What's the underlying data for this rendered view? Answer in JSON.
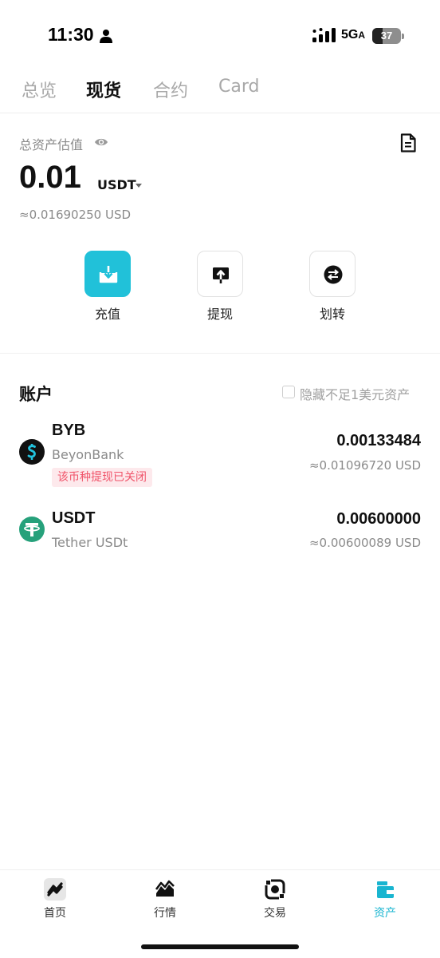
{
  "status_bar": {
    "time": "11:30",
    "network": "5G",
    "network_suffix": "A",
    "battery": "37",
    "icons": [
      "person-icon",
      "signal-icon",
      "battery-icon"
    ]
  },
  "tabs": [
    {
      "label": "总览",
      "active": false
    },
    {
      "label": "现货",
      "active": true
    },
    {
      "label": "合约",
      "active": false
    },
    {
      "label": "Card",
      "active": false
    }
  ],
  "summary": {
    "label": "总资产估值",
    "value": "0.01",
    "currency": "USDT",
    "usd_equiv": "≈0.01690250 USD",
    "icons": [
      "eye-icon",
      "document-icon",
      "caret-down-icon"
    ]
  },
  "actions": [
    {
      "label": "充值",
      "icon": "deposit-icon",
      "primary": true
    },
    {
      "label": "提现",
      "icon": "withdraw-icon",
      "primary": false
    },
    {
      "label": "划转",
      "icon": "transfer-icon",
      "primary": false
    }
  ],
  "accounts": {
    "title": "账户",
    "hide_small_label": "隐藏不足1美元资产",
    "hide_small_checked": false,
    "items": [
      {
        "symbol": "BYB",
        "name": "BeyonBank",
        "badge": "该币种提现已关闭",
        "amount": "0.00133484",
        "usd_equiv": "≈0.01096720  USD",
        "icon": "byb-coin-icon",
        "icon_color": "#111111"
      },
      {
        "symbol": "USDT",
        "name": "Tether USDt",
        "amount": "0.00600000",
        "usd_equiv": "≈0.00600089  USD",
        "icon": "tether-coin-icon",
        "icon_color": "#26a17b"
      }
    ]
  },
  "bottom_nav": [
    {
      "label": "首页",
      "icon": "home-icon",
      "active": false
    },
    {
      "label": "行情",
      "icon": "market-icon",
      "active": false
    },
    {
      "label": "交易",
      "icon": "trade-icon",
      "active": false
    },
    {
      "label": "资产",
      "icon": "wallet-icon",
      "active": true
    }
  ],
  "colors": {
    "accent": "#21c1d9",
    "nav_active": "#19b5d0",
    "badge_text": "#f0546a",
    "badge_bg": "#fde9ec"
  }
}
